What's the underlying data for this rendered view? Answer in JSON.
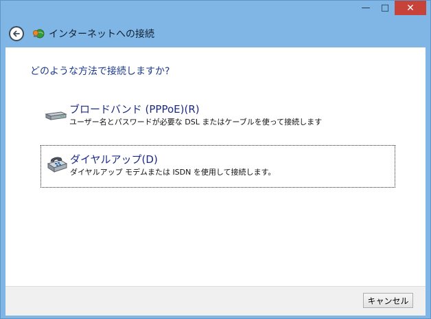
{
  "window": {
    "title": "インターネットへの接続",
    "minimize": "—",
    "maximize": "□",
    "close": "✕"
  },
  "question": "どのような方法で接続しますか?",
  "options": [
    {
      "title": "ブロードバンド (PPPoE)(R)",
      "description": "ユーザー名とパスワードが必要な DSL またはケーブルを使って接続します",
      "icon": "broadband-modem-icon"
    },
    {
      "title": "ダイヤルアップ(D)",
      "description": "ダイヤルアップ モデムまたは ISDN を使用して接続します。",
      "icon": "dialup-phone-icon"
    }
  ],
  "footer": {
    "cancel_label": "キャンセル"
  },
  "colors": {
    "frame": "#7fb6e6",
    "close_button": "#c7433a",
    "link_text": "#1c2a86",
    "question_text": "#1b3a8c"
  }
}
